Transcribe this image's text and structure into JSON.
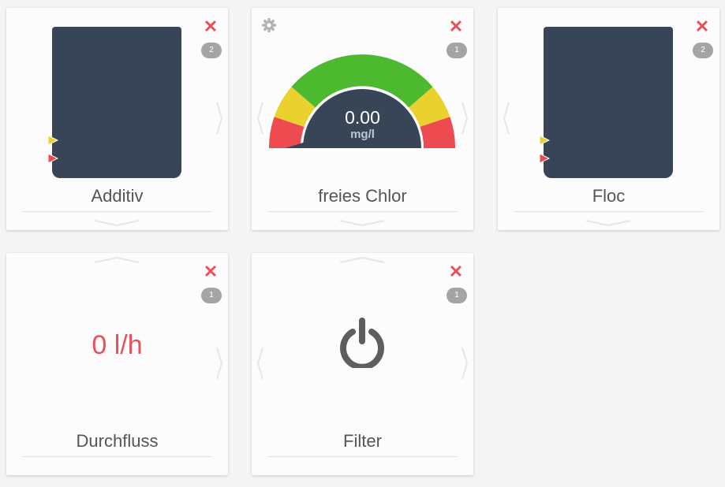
{
  "colors": {
    "close": "#e8505b",
    "badge": "#a4a4a4",
    "tank": "#384557",
    "gauge_red": "#ee4b50",
    "gauge_yellow": "#ead12e",
    "gauge_green": "#4db92f",
    "flow_value": "#e8505b"
  },
  "cards": [
    {
      "id": "additiv",
      "label": "Additiv",
      "badge": "2",
      "close_icon": "close-icon",
      "type": "tank"
    },
    {
      "id": "chlor",
      "label": "freies Chlor",
      "badge": "1",
      "close_icon": "close-icon",
      "type": "gauge",
      "gauge": {
        "value": "0.00",
        "unit": "mg/l"
      }
    },
    {
      "id": "floc",
      "label": "Floc",
      "badge": "2",
      "close_icon": "close-icon",
      "type": "tank"
    },
    {
      "id": "durchfluss",
      "label": "Durchfluss",
      "badge": "1",
      "close_icon": "close-icon",
      "type": "value",
      "value": "0 l/h"
    },
    {
      "id": "filter",
      "label": "Filter",
      "badge": "1",
      "close_icon": "close-icon",
      "type": "power"
    }
  ]
}
